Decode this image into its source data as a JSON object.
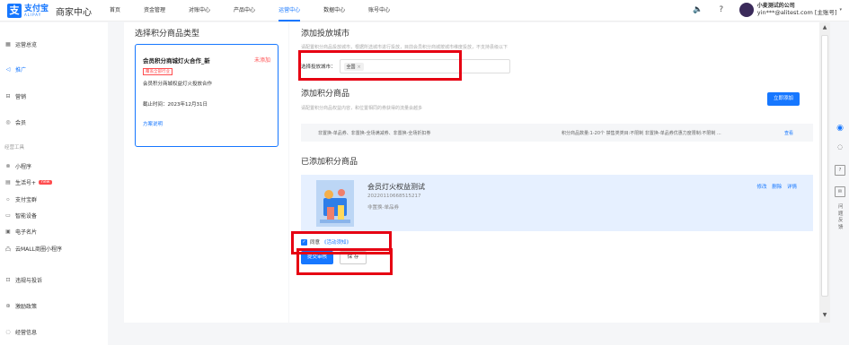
{
  "header": {
    "logo": {
      "cn": "支付宝",
      "en": "ALIPAY"
    },
    "app_name": "商家中心",
    "nav": [
      "首页",
      "资金管理",
      "对账中心",
      "产品中心",
      "运营中心",
      "数据中心",
      "账号中心"
    ],
    "active_nav": "运营中心",
    "user": {
      "name": "小麦测试的公司",
      "account": "yin***@alitest.com [主账号]"
    }
  },
  "sidebar": {
    "items": [
      {
        "label": "运营总览",
        "icon": "grid-icon"
      },
      {
        "label": "推广",
        "icon": "megaphone-icon",
        "active": true
      },
      {
        "label": "营销",
        "icon": "gift-icon"
      },
      {
        "label": "会员",
        "icon": "member-icon"
      }
    ],
    "group_label": "经营工具",
    "tools": [
      {
        "label": "小程序",
        "icon": "miniapp-icon"
      },
      {
        "label": "生活号+",
        "icon": "life-icon",
        "badge": "new"
      },
      {
        "label": "支付宝群",
        "icon": "group-icon"
      },
      {
        "label": "智能设备",
        "icon": "device-icon"
      },
      {
        "label": "电子名片",
        "icon": "card-icon"
      },
      {
        "label": "云MALL商圈小程序",
        "icon": "mall-icon"
      }
    ],
    "bottom": [
      {
        "label": "违规与投诉",
        "icon": "warning-icon"
      },
      {
        "label": "激励政策",
        "icon": "incentive-icon"
      },
      {
        "label": "经营信息",
        "icon": "info-icon"
      }
    ]
  },
  "left_panel": {
    "title": "选择积分商品类型",
    "card": {
      "title": "会员积分商城灯火合作_新",
      "status": "未添加",
      "tag": "覆盖全部行业",
      "desc": "会员积分商城权益灯火投放合作",
      "deadline": "截止时间：2023年12月31日",
      "link": "方案说明"
    }
  },
  "main": {
    "city_section": {
      "title": "添加投放城市",
      "desc": "请配置积分商品投放城市，根据所选城市进行投放，目前会员积分商城按城市维度投放，不支持县级以下",
      "label": "选择投放城市：",
      "chip": "全国",
      "chip_close": "×"
    },
    "goods_section": {
      "title": "添加积分商品",
      "desc": "请配置积分商品权益内容，和位置相同的券获得的流量会越多",
      "add_button": "立即添加",
      "rule_left": "非置换-单品券、非置换-全场满减券、非置换-全场折扣券",
      "rule_right": "积分商品数量:1-20个 禁售类类目:不限制 非置换-单品券优惠力度限制:不限制 ...",
      "rule_view": "查看"
    },
    "added_section": {
      "title": "已添加积分商品",
      "item": {
        "name": "会员灯火权益测试",
        "id": "20220110668515217",
        "type": "非置换-单品券",
        "actions": [
          "修改",
          "删除",
          "详情"
        ]
      }
    },
    "agree": {
      "checkbox": "✓",
      "text": "同意",
      "link": "《活动须知》"
    },
    "submit_button": "提交审核",
    "save_button": "保 存"
  },
  "right_tools": {
    "feedback": "问题反馈"
  },
  "colors": {
    "primary": "#1677ff",
    "highlight_box": "#e60012",
    "status": "#ff4d4f",
    "added_bg": "#e6f0ff"
  }
}
